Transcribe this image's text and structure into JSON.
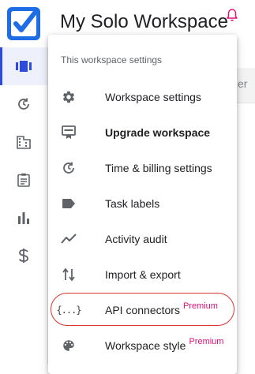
{
  "header": {
    "workspace_title": "My Solo Workspace"
  },
  "background": {
    "column_header_partial": "er"
  },
  "menu": {
    "heading": "This workspace settings",
    "items": [
      {
        "label": "Workspace settings",
        "icon": "gear-icon"
      },
      {
        "label": "Upgrade workspace",
        "icon": "upgrade-icon"
      },
      {
        "label": "Time & billing settings",
        "icon": "clock-refresh-icon"
      },
      {
        "label": "Task labels",
        "icon": "label-icon"
      },
      {
        "label": "Activity audit",
        "icon": "trend-line-icon"
      },
      {
        "label": "Import & export",
        "icon": "import-export-icon"
      },
      {
        "label": "API connectors",
        "icon": "braces-icon",
        "badge": "Premium"
      },
      {
        "label": "Workspace style",
        "icon": "palette-icon",
        "badge": "Premium"
      }
    ],
    "api_braces_glyph": "{...}"
  },
  "colors": {
    "brand": "#1f6de6",
    "active_rail": "#2d4bdc",
    "premium": "#e0127a",
    "highlight_ring": "#d9342b"
  }
}
